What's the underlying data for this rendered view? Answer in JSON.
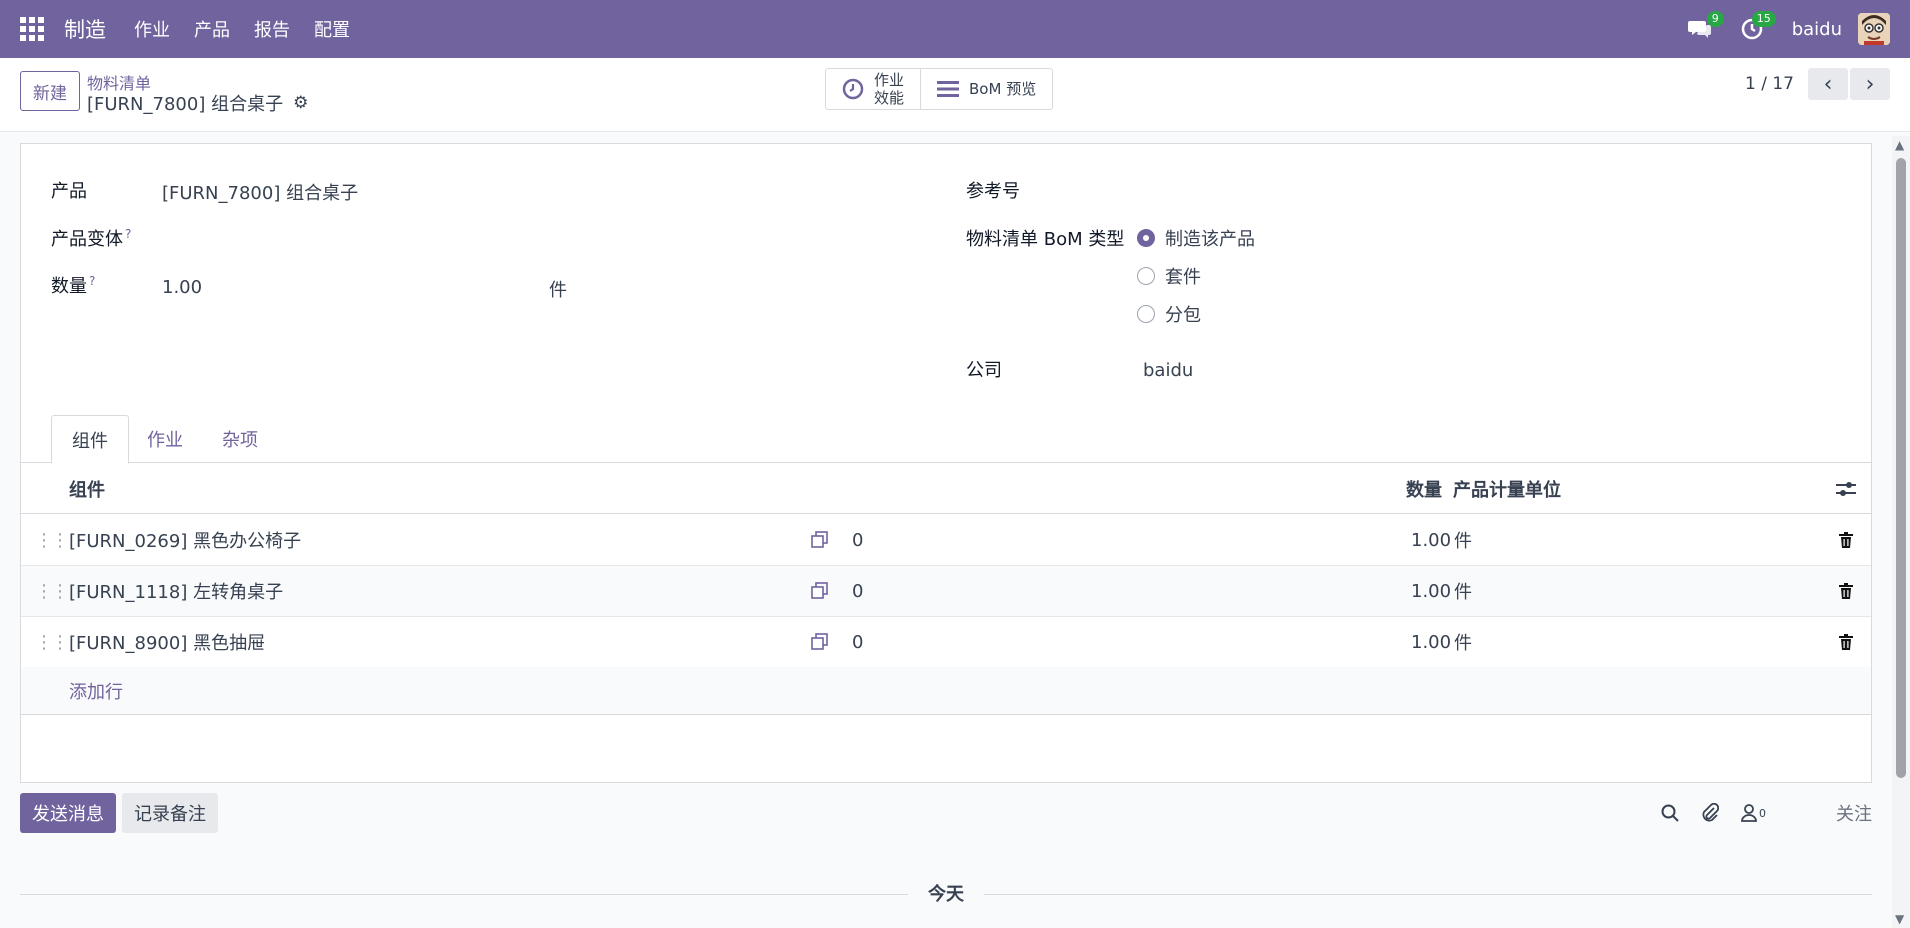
{
  "navbar": {
    "brand": "制造",
    "menu": [
      "作业",
      "产品",
      "报告",
      "配置"
    ],
    "messages_count": "9",
    "activities_count": "15",
    "user": "baidu"
  },
  "control": {
    "new_label": "新建",
    "breadcrumb": "物料清单",
    "record_title": "[FURN_7800] 组合桌子",
    "smart_work_line1": "作业",
    "smart_work_line2": "效能",
    "smart_bom": "BoM 预览",
    "pager": "1 / 17"
  },
  "form": {
    "product_label": "产品",
    "product_value": "[FURN_7800] 组合桌子",
    "variant_label": "产品变体",
    "qty_label": "数量",
    "qty_value": "1.00",
    "qty_uom": "件",
    "help_mark": "?",
    "ref_label": "参考号",
    "bomtype_label": "物料清单 BoM 类型",
    "bomtype_options": [
      "制造该产品",
      "套件",
      "分包"
    ],
    "company_label": "公司",
    "company_value": "baidu"
  },
  "tabs": [
    "组件",
    "作业",
    "杂项"
  ],
  "table": {
    "headers": {
      "component": "组件",
      "qty": "数量",
      "uom": "产品计量单位"
    },
    "rows": [
      {
        "component": "[FURN_0269] 黑色办公椅子",
        "count": "0",
        "qty": "1.00",
        "uom": "件"
      },
      {
        "component": "[FURN_1118] 左转角桌子",
        "count": "0",
        "qty": "1.00",
        "uom": "件"
      },
      {
        "component": "[FURN_8900] 黑色抽屉",
        "count": "0",
        "qty": "1.00",
        "uom": "件"
      }
    ],
    "add_line": "添加行"
  },
  "chatter": {
    "send_message": "发送消息",
    "log_note": "记录备注",
    "followers_count": "0",
    "follow": "关注",
    "today": "今天"
  },
  "colors": {
    "brand": "#71639e",
    "success": "#28a745"
  }
}
